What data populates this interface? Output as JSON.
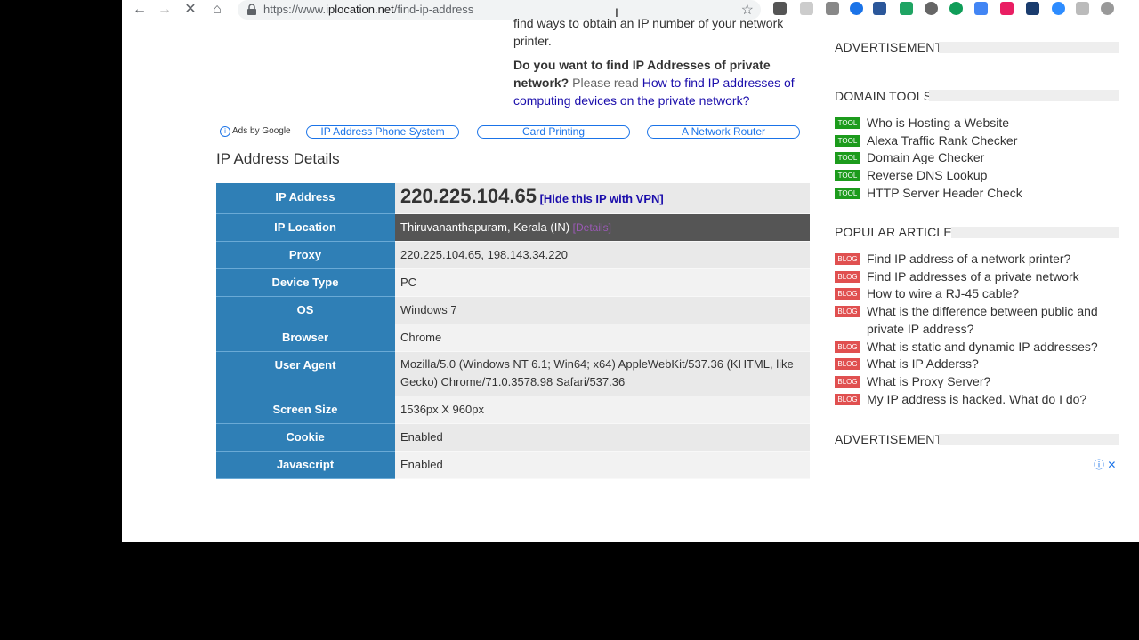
{
  "browser": {
    "url_prefix": "https://www.",
    "url_host": "iplocation.net",
    "url_path": "/find-ip-address",
    "back": "←",
    "forward": "→",
    "stop": "✕",
    "home": "⌂",
    "star": "☆"
  },
  "snippet": {
    "top_lines": [
      "find ways to obtain an IP number of your network",
      "printer."
    ],
    "question": "Do you want to find IP Addresses of private network?",
    "please": "Please read",
    "link": "How to find IP addresses of computing devices on the private network?"
  },
  "ads": {
    "label": "Ads by Google",
    "pills": [
      "IP Address Phone System",
      "Card Printing",
      "A Network Router"
    ]
  },
  "details": {
    "title": "IP Address Details",
    "ip": "220.225.104.65",
    "vpn_link": "[Hide this IP with VPN]",
    "details_link": "[Details]",
    "rows": [
      {
        "label": "IP Address",
        "value": ""
      },
      {
        "label": "IP Location",
        "value": "Thiruvananthapuram, Kerala (IN)"
      },
      {
        "label": "Proxy",
        "value": "220.225.104.65, 198.143.34.220"
      },
      {
        "label": "Device Type",
        "value": "PC"
      },
      {
        "label": "OS",
        "value": "Windows 7"
      },
      {
        "label": "Browser",
        "value": "Chrome"
      },
      {
        "label": "User Agent",
        "value": "Mozilla/5.0 (Windows NT 6.1; Win64; x64) AppleWebKit/537.36 (KHTML, like Gecko) Chrome/71.0.3578.98 Safari/537.36"
      },
      {
        "label": "Screen Size",
        "value": "1536px X 960px"
      },
      {
        "label": "Cookie",
        "value": "Enabled"
      },
      {
        "label": "Javascript",
        "value": "Enabled"
      }
    ]
  },
  "sidebar": {
    "advertisement_top": "ADVERTISEMENT",
    "domain_tools_heading": "DOMAIN TOOLS",
    "tool_tag": "TOOL",
    "tools": [
      "Who is Hosting a Website",
      "Alexa Traffic Rank Checker",
      "Domain Age Checker",
      "Reverse DNS Lookup",
      "HTTP Server Header Check"
    ],
    "popular_heading": "POPULAR ARTICLES",
    "blog_tag": "BLOG",
    "articles": [
      "Find IP address of a network printer?",
      "Find IP addresses of a private network",
      "How to wire a RJ-45 cable?",
      "What is the difference between public and private IP address?",
      "What is static and dynamic IP addresses?",
      "What is IP Adderss?",
      "What is Proxy Server?",
      "My IP address is hacked. What do I do?"
    ],
    "advertisement_bottom": "ADVERTISEMENT",
    "adchoices": "ⓘ ✕"
  },
  "colors": {
    "label_blue": "#2f7fb6",
    "tool_green": "#1c9b1c",
    "blog_red": "#e05050",
    "link_blue": "#1a0dab"
  }
}
